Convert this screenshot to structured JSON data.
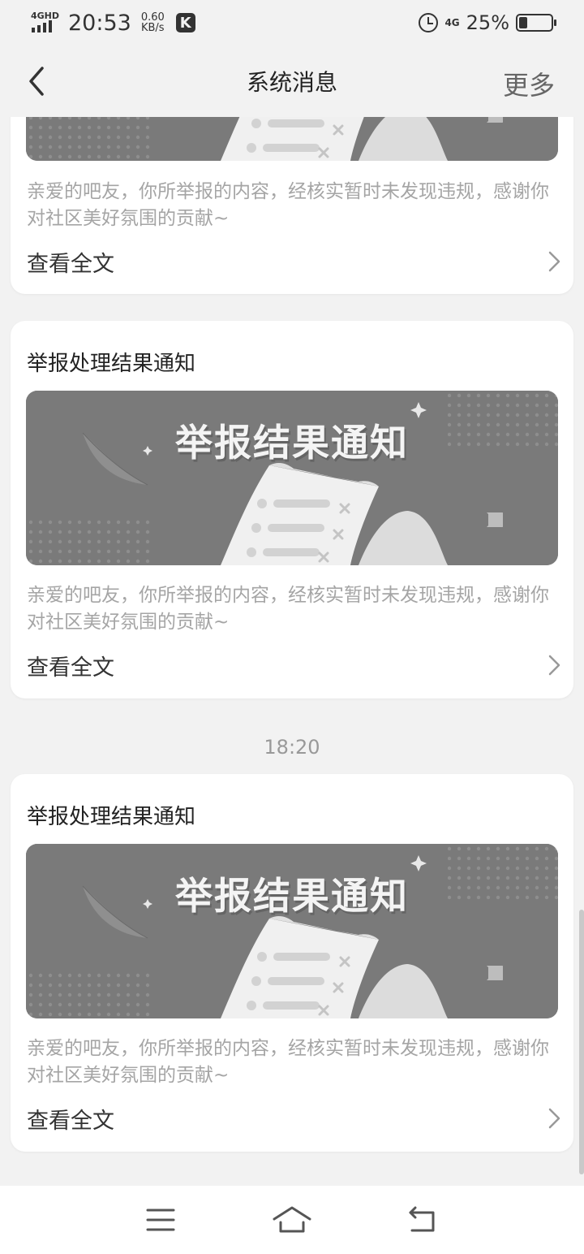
{
  "status_bar": {
    "network": "4GHD",
    "time": "20:53",
    "speed_value": "0.60",
    "speed_unit": "KB/s",
    "app_badge": "K",
    "network2": "4G",
    "battery_text": "25%",
    "battery_level": 0.25
  },
  "header": {
    "back_icon": "chevron-left-icon",
    "title": "系统消息",
    "more_label": "更多"
  },
  "messages": [
    {
      "title": "",
      "banner_text": "",
      "description": "亲爱的吧友，你所举报的内容，经核实暂时未发现违规，感谢你对社区美好氛围的贡献~",
      "view_label": "查看全文"
    },
    {
      "title": "举报处理结果通知",
      "banner_text": "举报结果通知",
      "description": "亲爱的吧友，你所举报的内容，经核实暂时未发现违规，感谢你对社区美好氛围的贡献~",
      "view_label": "查看全文"
    },
    {
      "time_separator": "18:20",
      "title": "举报处理结果通知",
      "banner_text": "举报结果通知",
      "description": "亲爱的吧友，你所举报的内容，经核实暂时未发现违规，感谢你对社区美好氛围的贡献~",
      "view_label": "查看全文"
    }
  ],
  "system_nav": {
    "menu_icon": "menu-icon",
    "home_icon": "home-icon",
    "back_icon": "back-icon"
  },
  "colors": {
    "background": "#f2f2f2",
    "card": "#ffffff",
    "banner": "#7a7a7a",
    "description_text": "#a5a5a5"
  }
}
